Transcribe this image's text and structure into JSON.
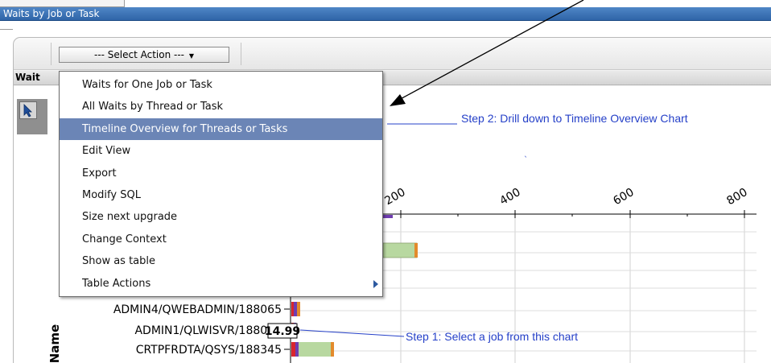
{
  "window": {
    "title": "Waits by Job or Task"
  },
  "toolbar": {
    "select_action_label": "--- Select Action ---"
  },
  "view": {
    "header_label": "Wait"
  },
  "menu": {
    "items": [
      {
        "label": "Waits for One Job or Task",
        "highlighted": false,
        "has_submenu": false
      },
      {
        "label": "All Waits by Thread or Task",
        "highlighted": false,
        "has_submenu": false
      },
      {
        "label": "Timeline Overview for Threads or Tasks",
        "highlighted": true,
        "has_submenu": false
      },
      {
        "label": "Edit View",
        "highlighted": false,
        "has_submenu": false
      },
      {
        "label": "Export",
        "highlighted": false,
        "has_submenu": false
      },
      {
        "label": "Modify SQL",
        "highlighted": false,
        "has_submenu": false
      },
      {
        "label": "Size next upgrade",
        "highlighted": false,
        "has_submenu": false
      },
      {
        "label": "Change Context",
        "highlighted": false,
        "has_submenu": false
      },
      {
        "label": "Show as table",
        "highlighted": false,
        "has_submenu": false
      },
      {
        "label": "Table Actions",
        "highlighted": false,
        "has_submenu": true
      }
    ],
    "highlight_color": "#6b85b6"
  },
  "annotations": {
    "step2": "Step 2: Drill down to Timeline Overview Chart",
    "step1": "Step 1: Select a job from this chart",
    "color": "#2540c8"
  },
  "chart_data": {
    "type": "bar",
    "orientation": "horizontal",
    "x_ticks": [
      "200",
      "400",
      "600",
      "800"
    ],
    "y_axis_label": "Name",
    "categories": [
      "ADMIN4/QWEBADMIN/188065",
      "ADMIN1/QLWISVR/188066",
      "CRTPFRDTA/QSYS/188345"
    ],
    "tooltip_value": "14.99",
    "bar_colors": {
      "red": "#d8262f",
      "purple": "#6f3db0",
      "green": "#b8d8a0",
      "orange": "#e38a2c"
    }
  }
}
